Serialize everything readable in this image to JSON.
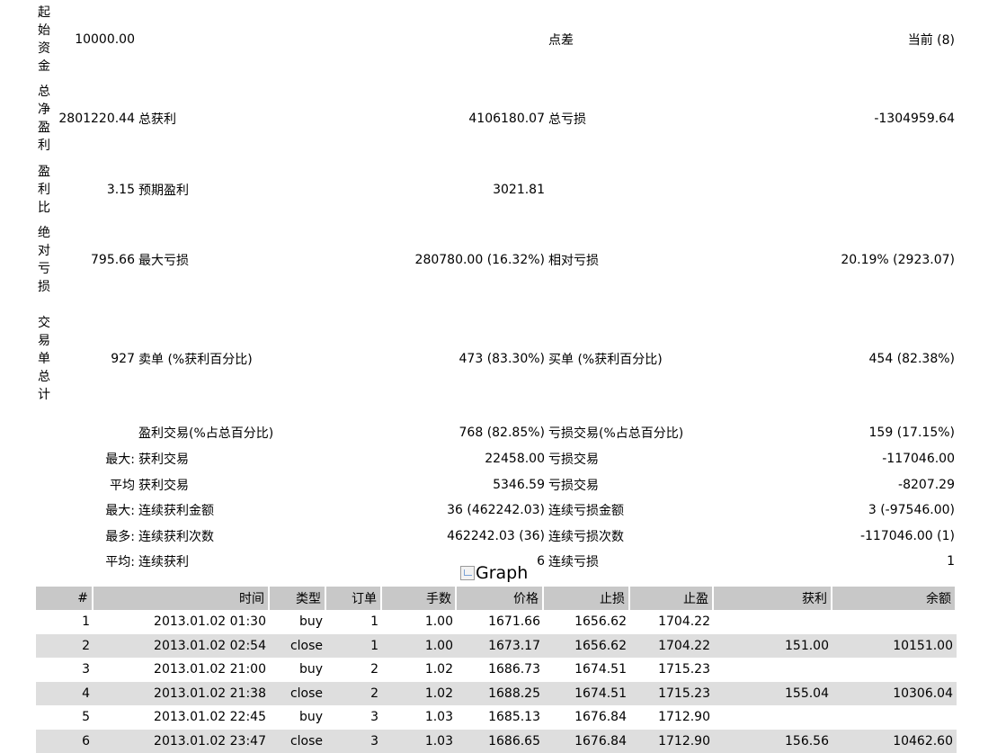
{
  "summary": {
    "initial_deposit": {
      "label": "起始资金",
      "value": "10000.00"
    },
    "spread": {
      "label": "点差",
      "value": "当前 (8)"
    },
    "total_net_profit": {
      "label": "总净盈利",
      "value": "2801220.44"
    },
    "gross_profit": {
      "label": "总获利",
      "value": "4106180.07"
    },
    "gross_loss": {
      "label": "总亏损",
      "value": "-1304959.64"
    },
    "profit_factor": {
      "label": "盈利比",
      "value": "3.15"
    },
    "expected_payoff": {
      "label": "预期盈利",
      "value": "3021.81"
    },
    "absolute_drawdown": {
      "label": "绝对亏损",
      "value": "795.66"
    },
    "maximal_drawdown": {
      "label": "最大亏损",
      "value": "280780.00 (16.32%)"
    },
    "relative_drawdown": {
      "label": "相对亏损",
      "value": "20.19% (2923.07)"
    },
    "total_trades": {
      "label": "交易单总计",
      "value": "927"
    },
    "short_positions": {
      "label": "卖单 (%获利百分比)",
      "value": "473 (83.30%)"
    },
    "long_positions": {
      "label": "买单 (%获利百分比)",
      "value": "454 (82.38%)"
    },
    "profit_trades": {
      "label": "盈利交易(%占总百分比)",
      "value": "768 (82.85%)"
    },
    "loss_trades": {
      "label": "亏损交易(%占总百分比)",
      "value": "159 (17.15%)"
    },
    "largest": {
      "prefix": "最大:",
      "profit_label": "获利交易",
      "profit_value": "22458.00",
      "loss_label": "亏损交易",
      "loss_value": "-117046.00"
    },
    "average": {
      "prefix": "平均",
      "profit_label": "获利交易",
      "profit_value": "5346.59",
      "loss_label": "亏损交易",
      "loss_value": "-8207.29"
    },
    "max_consecutive": {
      "prefix": "最大:",
      "wins_label": "连续获利金额",
      "wins_value": "36 (462242.03)",
      "losses_label": "连续亏损金额",
      "losses_value": "3 (-97546.00)"
    },
    "maximal_consecutive": {
      "prefix": "最多:",
      "profit_label": "连续获利次数",
      "profit_value": "462242.03 (36)",
      "loss_label": "连续亏损次数",
      "loss_value": "-117046.00 (1)"
    },
    "avg_consecutive": {
      "prefix": "平均:",
      "wins_label": "连续获利",
      "wins_value": "6",
      "losses_label": "连续亏损",
      "losses_value": "1"
    }
  },
  "graph_alt": "Graph",
  "trades": {
    "columns": [
      "#",
      "时间",
      "类型",
      "订单",
      "手数",
      "价格",
      "止损",
      "止盈",
      "获利",
      "余额"
    ],
    "rows": [
      [
        "1",
        "2013.01.02 01:30",
        "buy",
        "1",
        "1.00",
        "1671.66",
        "1656.62",
        "1704.22",
        "",
        ""
      ],
      [
        "2",
        "2013.01.02 02:54",
        "close",
        "1",
        "1.00",
        "1673.17",
        "1656.62",
        "1704.22",
        "151.00",
        "10151.00"
      ],
      [
        "3",
        "2013.01.02 21:00",
        "buy",
        "2",
        "1.02",
        "1686.73",
        "1674.51",
        "1715.23",
        "",
        ""
      ],
      [
        "4",
        "2013.01.02 21:38",
        "close",
        "2",
        "1.02",
        "1688.25",
        "1674.51",
        "1715.23",
        "155.04",
        "10306.04"
      ],
      [
        "5",
        "2013.01.02 22:45",
        "buy",
        "3",
        "1.03",
        "1685.13",
        "1676.84",
        "1712.90",
        "",
        ""
      ],
      [
        "6",
        "2013.01.02 23:47",
        "close",
        "3",
        "1.03",
        "1686.65",
        "1676.84",
        "1712.90",
        "156.56",
        "10462.60"
      ]
    ]
  }
}
